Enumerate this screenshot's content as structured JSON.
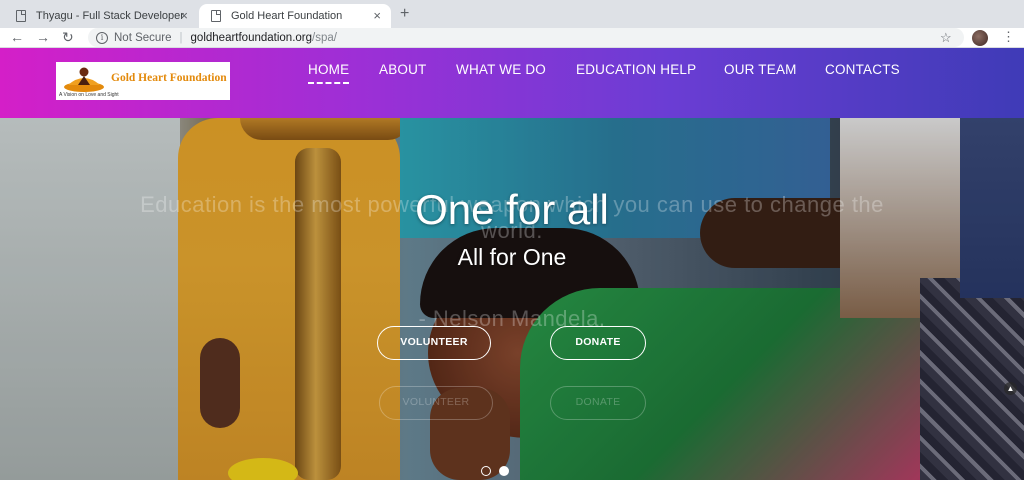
{
  "browser": {
    "tabs": [
      {
        "title": "Thyagu - Full Stack Developer",
        "active": false
      },
      {
        "title": "Gold Heart Foundation",
        "active": true
      }
    ],
    "new_tab_icon": "+",
    "close_icon": "×",
    "omnibox": {
      "security": "Not Secure",
      "separator": "|",
      "host": "goldheartfoundation.org",
      "path": "/spa/"
    }
  },
  "site": {
    "logo": {
      "name": "Gold Heart Foundation",
      "tagline": "A Vision on Love and Sight"
    },
    "nav": [
      "HOME",
      "ABOUT",
      "WHAT WE DO",
      "EDUCATION HELP",
      "OUR TEAM",
      "CONTACTS"
    ],
    "active_nav": "HOME",
    "colors": {
      "header_start": "#d41fc8",
      "header_end": "#3f3bb7"
    }
  },
  "hero": {
    "title": "One for all",
    "subtitle": "All for One",
    "ghost_quote_line1": "Education is the most powerful weapon which you can use to change the",
    "ghost_quote_line2": "world.",
    "ghost_author": "- Nelson Mandela.",
    "buttons": {
      "volunteer": "VOLUNTEER",
      "donate": "DONATE"
    },
    "ghost_buttons": {
      "volunteer": "VOLUNTEER",
      "donate": "DONATE"
    },
    "slider": {
      "count": 2,
      "active_index": 1
    }
  }
}
